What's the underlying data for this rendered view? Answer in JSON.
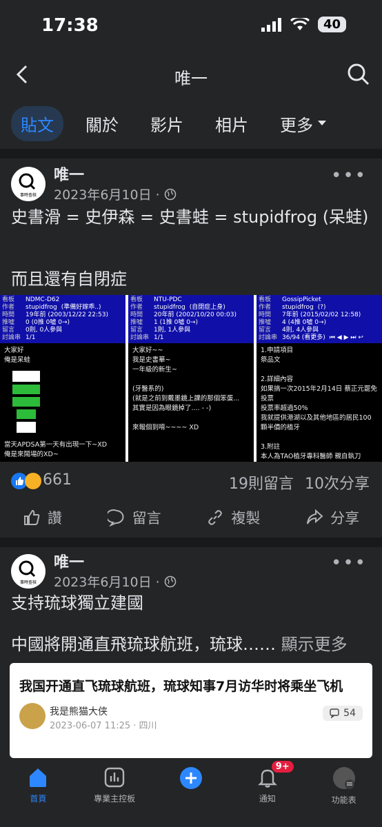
{
  "status": {
    "time": "17:38",
    "battery": "40"
  },
  "header": {
    "title": "唯一"
  },
  "tabs": [
    {
      "label": "貼文"
    },
    {
      "label": "關於"
    },
    {
      "label": "影片"
    },
    {
      "label": "相片"
    },
    {
      "label": "更多"
    }
  ],
  "posts": [
    {
      "author": "唯一",
      "date": "2023年6月10日 ·",
      "avatar_text": "事時查核",
      "text_line1": "史書滑 = 史伊森 = 史書蛙 = stupidfrog (呆蛙)",
      "text_line2": "而且還有自閉症",
      "image_panels": [
        {
          "board": "NDMC-D62",
          "author_id": "stupidfrog",
          "author_note": "(準備好嫁乖..)",
          "time": "19年前 (2003/12/22 22:53)",
          "push": "0 (0推 0噓 0→)",
          "comments": "0則, 0人參與",
          "page": "1/1",
          "body": [
            "大家好",
            "俺是呆蛙",
            "",
            "當天APDSA第一天有出現一下~XD",
            "俺是來鬧場的XD~"
          ]
        },
        {
          "board": "NTU-PDC",
          "author_id": "stupidfrog",
          "author_note": "(自閉症上身)",
          "time": "20年前 (2002/10/20 00:03)",
          "push": "1 (1推 0噓 0→)",
          "comments": "1則, 1人參與",
          "page": "1/1",
          "body": [
            "大家好~~",
            "我是史書華~",
            "一年級的新生~",
            "",
            "(牙醫系的)",
            "(就是之前到戴墨鏡上課的那個笨蛋...",
            "其實是因為眼鏡掉了.... - -)",
            "",
            "來報個到唷~~~~ XD"
          ]
        },
        {
          "board": "GossipPicket",
          "author_id": "stupidfrog",
          "author_note": "(?)",
          "time": "7年前 (2015/02/02 12:58)",
          "push": "4 (4推 0噓 0→)",
          "comments": "4則, 4人參與",
          "page": "36/94 (看更多)",
          "body": [
            "1.申請項目",
            "祭品文",
            "",
            "2.詳細內容",
            "如果搞一次2015年2月14日 蔡正元罷免投票",
            "投票率超過50%",
            "我就提供港湖以及其他地區的居民100顆半價的植牙",
            "",
            "3.附註",
            "本人為TAO植牙專科醫師 親自執刀"
          ]
        }
      ],
      "panel_labels": {
        "board": "看板",
        "author": "作者",
        "time": "時間",
        "push": "推噓",
        "comments": "留言",
        "thread": "討論串"
      },
      "reaction_count": "661",
      "comment_count": "19則留言",
      "share_count": "10次分享"
    },
    {
      "author": "唯一",
      "date": "2023年6月10日 ·",
      "avatar_text": "事時查核",
      "text_line1": "支持琉球獨立建國",
      "text_line2": "中國將開通直飛琉球航班，琉球……",
      "see_more": "顯示更多",
      "preview": {
        "title": "我国开通直飞琉球航班，琉球知事7月访华时将乘坐飞机",
        "author": "我是熊猫大侠",
        "date": "2023-06-07 11:25 · 四川",
        "comments": "54"
      }
    }
  ],
  "actions": {
    "like": "讚",
    "comment": "留言",
    "copy": "複製",
    "share": "分享"
  },
  "bottom_nav": [
    {
      "label": "首頁",
      "icon": "home-icon"
    },
    {
      "label": "專業主控板",
      "icon": "dashboard-icon"
    },
    {
      "label": "",
      "icon": "plus-icon"
    },
    {
      "label": "通知",
      "icon": "bell-icon",
      "badge": "9+"
    },
    {
      "label": "功能表",
      "icon": "menu-icon"
    }
  ],
  "colors": {
    "accent": "#2d88ff",
    "background": "#242526",
    "badge": "#e41e3f"
  }
}
